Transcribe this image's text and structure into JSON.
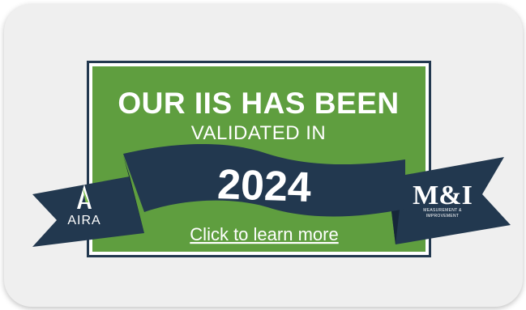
{
  "badge": {
    "headline": "OUR IIS HAS BEEN",
    "subheadline": "VALIDATED IN",
    "year": "2024",
    "link_text": "Click to learn more"
  },
  "logos": {
    "left": {
      "text": "AIRA",
      "icon": "aira-logo-icon"
    },
    "right": {
      "text": "M&I",
      "sub_line1": "MEASUREMENT &",
      "sub_line2": "IMPROVEMENT",
      "icon": "mi-logo-icon"
    }
  },
  "colors": {
    "card_background": "#efefef",
    "badge_green": "#5f9e3f",
    "navy": "#22384f",
    "white": "#ffffff"
  }
}
